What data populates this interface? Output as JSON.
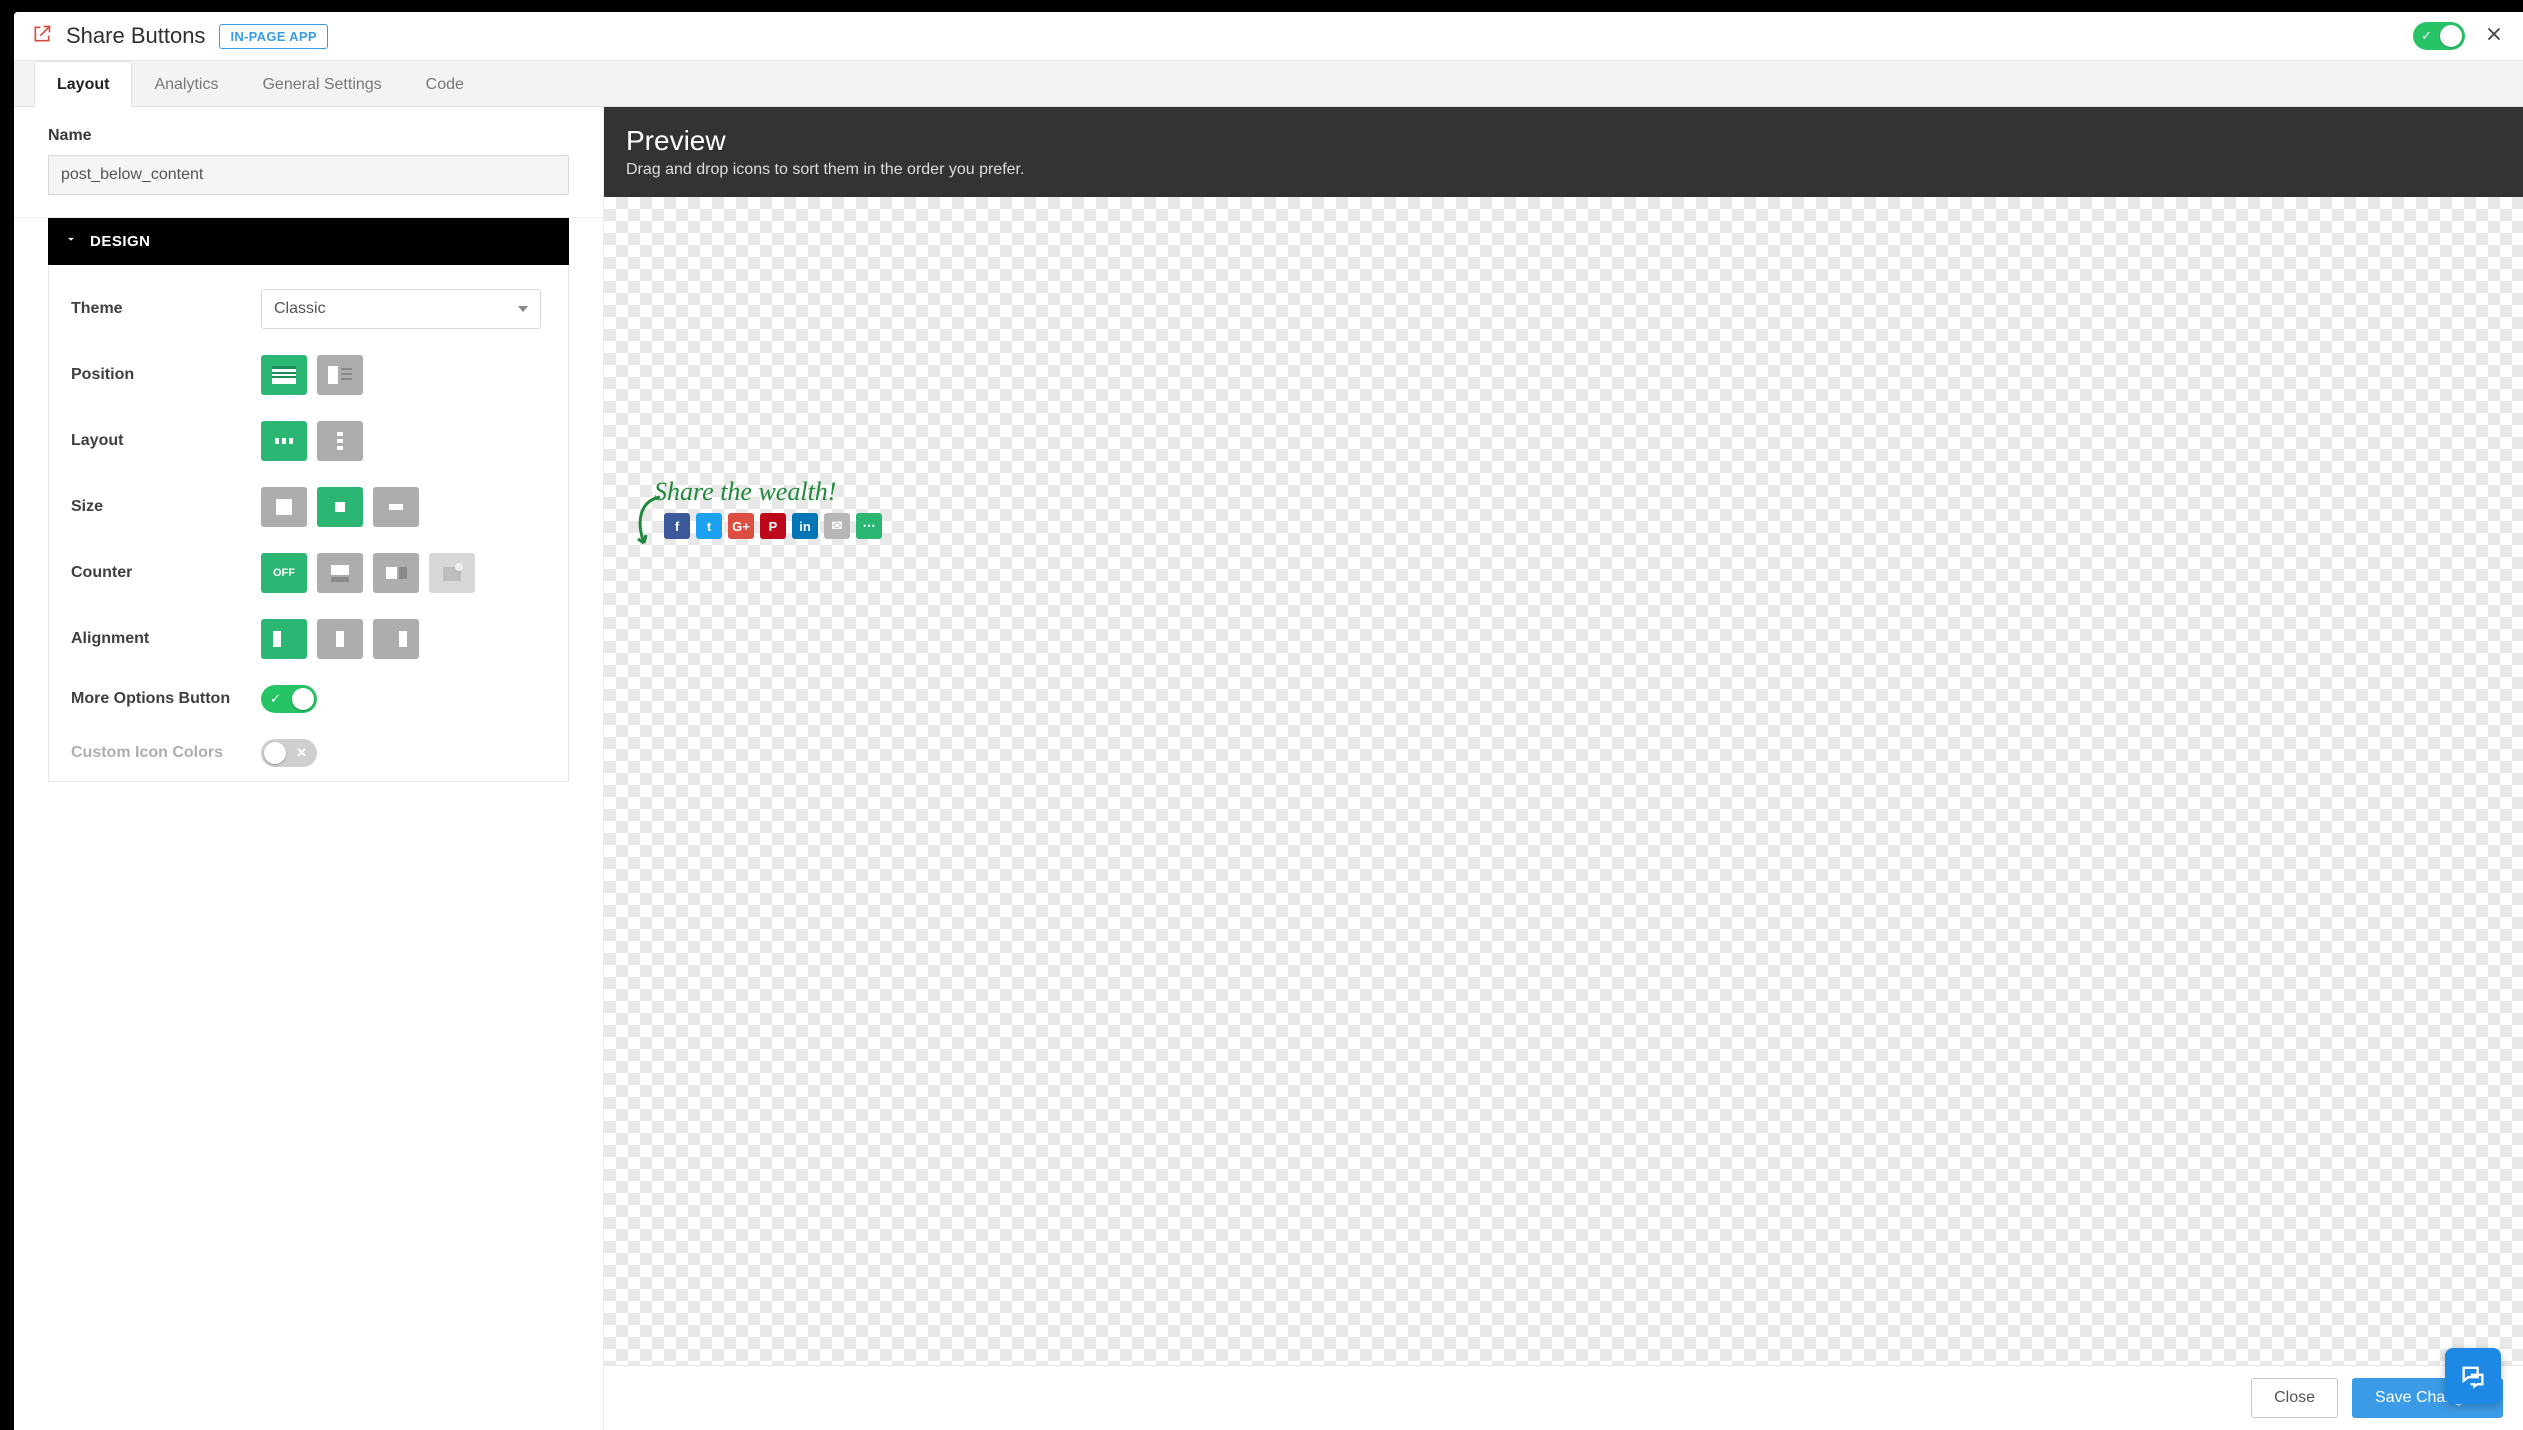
{
  "header": {
    "title": "Share Buttons",
    "badge": "IN-PAGE APP",
    "enabled": true
  },
  "tabs": [
    {
      "label": "Layout",
      "active": true
    },
    {
      "label": "Analytics"
    },
    {
      "label": "General Settings"
    },
    {
      "label": "Code"
    }
  ],
  "name_field": {
    "label": "Name",
    "value": "post_below_content"
  },
  "design_section": {
    "title": "DESIGN",
    "expanded": true,
    "theme_label": "Theme",
    "theme_value": "Classic",
    "position_label": "Position",
    "layout_label": "Layout",
    "size_label": "Size",
    "counter_label": "Counter",
    "counter_value": "OFF",
    "alignment_label": "Alignment",
    "more_options_label": "More Options Button",
    "more_options_on": true,
    "custom_colors_label": "Custom Icon Colors",
    "custom_colors_on": false
  },
  "preview": {
    "title": "Preview",
    "subtitle": "Drag and drop icons to sort them in the order you prefer.",
    "slogan": "Share the wealth!",
    "services": [
      {
        "code": "fb",
        "glyph": "f",
        "name": "facebook"
      },
      {
        "code": "tw",
        "glyph": "t",
        "name": "twitter"
      },
      {
        "code": "gp",
        "glyph": "G+",
        "name": "google-plus"
      },
      {
        "code": "pi",
        "glyph": "P",
        "name": "pinterest"
      },
      {
        "code": "li",
        "glyph": "in",
        "name": "linkedin"
      },
      {
        "code": "em",
        "glyph": "✉",
        "name": "email"
      },
      {
        "code": "mo",
        "glyph": "⋯",
        "name": "more"
      }
    ]
  },
  "footer": {
    "close": "Close",
    "save": "Save Changes"
  }
}
